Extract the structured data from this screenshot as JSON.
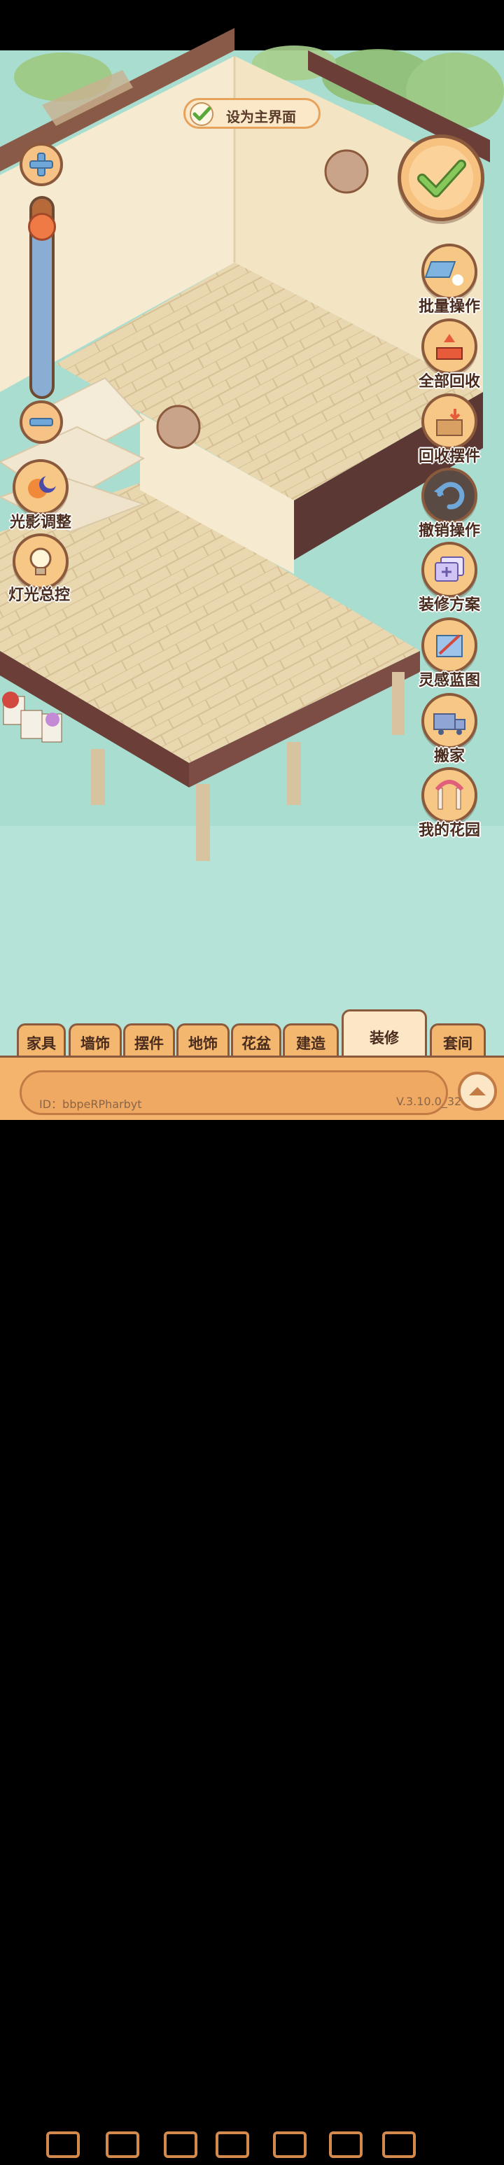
{
  "top_bar": {
    "set_main_label": "设为主界面"
  },
  "left_tools": {
    "zoom_level": 0.15,
    "light_shadow_label": "光影调整",
    "light_control_label": "灯光总控"
  },
  "right_menu": [
    {
      "label": "批量操作",
      "icon": "hand-tile-icon"
    },
    {
      "label": "全部回收",
      "icon": "recycle-tray-icon"
    },
    {
      "label": "回收摆件",
      "icon": "recycle-box-icon"
    },
    {
      "label": "撤销操作",
      "icon": "undo-icon"
    },
    {
      "label": "装修方案",
      "icon": "plan-cards-icon"
    },
    {
      "label": "灵感蓝图",
      "icon": "blueprint-icon"
    },
    {
      "label": "搬家",
      "icon": "moving-truck-icon"
    },
    {
      "label": "我的花园",
      "icon": "garden-arch-icon"
    }
  ],
  "tabs": [
    {
      "label": "家具"
    },
    {
      "label": "墙饰"
    },
    {
      "label": "摆件"
    },
    {
      "label": "地饰"
    },
    {
      "label": "花盆"
    },
    {
      "label": "建造"
    },
    {
      "label": "装修",
      "active": true
    },
    {
      "label": "套间"
    }
  ],
  "toolbar": {
    "tools": [
      "fence-icon",
      "floor-tile-icon",
      "wall-icon",
      "railing-icon",
      "stairs-icon",
      "bridge-icon",
      "roof-icon"
    ],
    "player_id": "ID：bbpeRPharbyt",
    "version": "V.3.10.0_32"
  },
  "colors": {
    "water": "#a9ddd0",
    "floor": "#e7d3ab",
    "wall": "#f7ecd2",
    "frame": "#6b3f38",
    "button": "#f7c786"
  }
}
